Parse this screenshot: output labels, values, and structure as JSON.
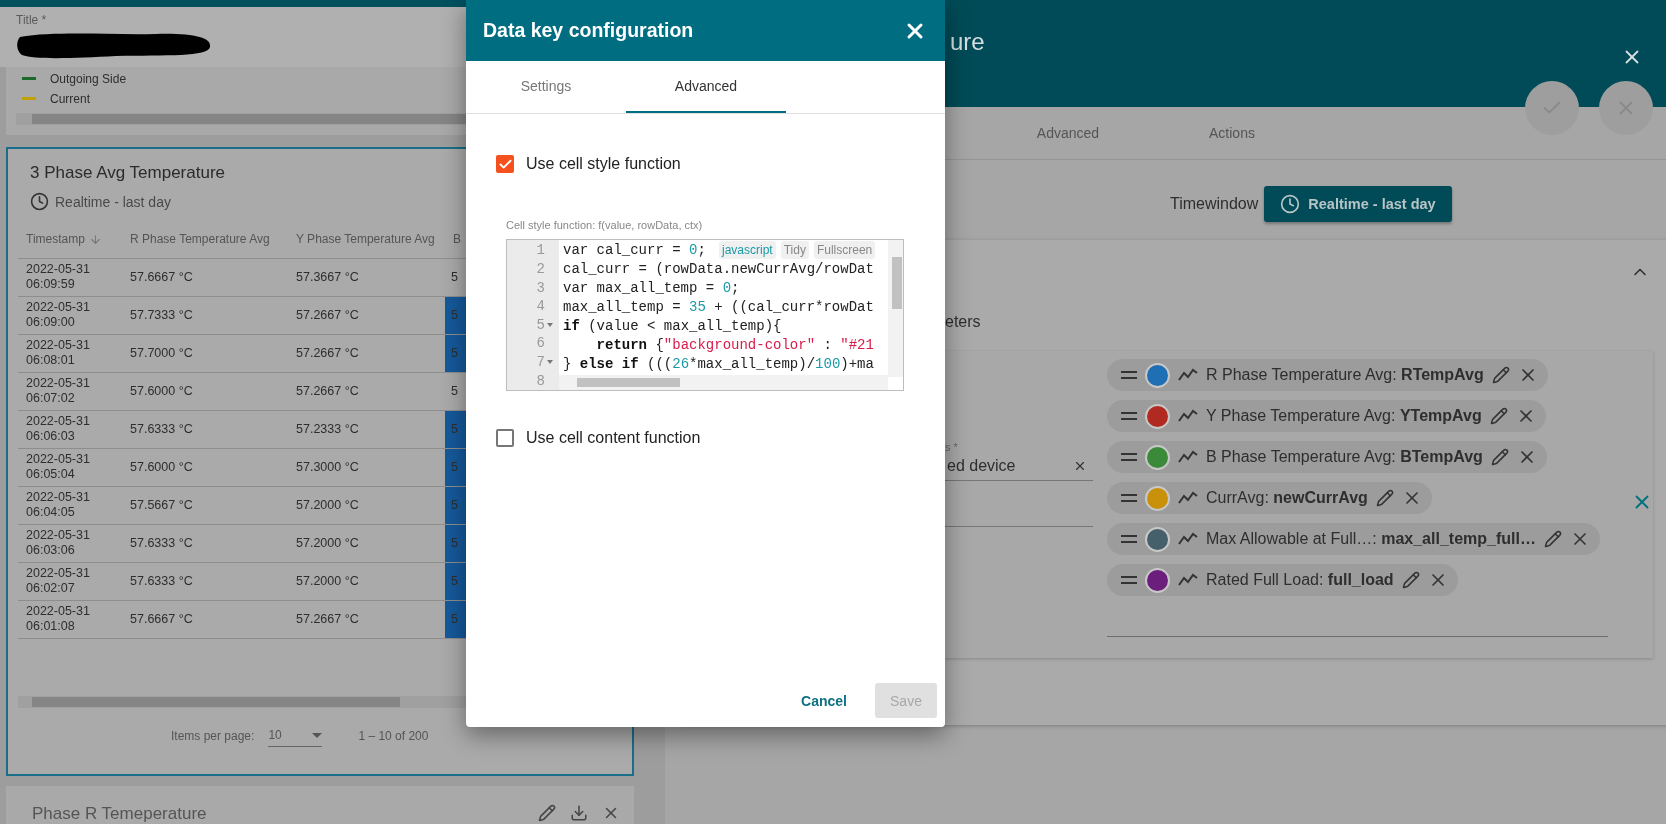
{
  "left_dashboard": {
    "title_field": {
      "label": "Title *"
    },
    "legend": [
      {
        "label": "Outgoing Side",
        "color": "#1b6a2a"
      },
      {
        "label": "Current",
        "color": "#c4a000"
      }
    ],
    "table_widget": {
      "title": "3 Phase Avg Temperature",
      "timewindow": "Realtime - last day",
      "columns": [
        {
          "label": "Timestamp",
          "sorted": true
        },
        {
          "label": "R Phase Temperature Avg",
          "sorted": false
        },
        {
          "label": "Y Phase Temperature Avg",
          "sorted": false
        },
        {
          "label": "B",
          "sorted": false
        }
      ],
      "rows": [
        {
          "date": "2022-05-31",
          "time": "06:09:59",
          "r": "57.6667 °C",
          "y": "57.3667 °C",
          "b": "5",
          "highlighted": false
        },
        {
          "date": "2022-05-31",
          "time": "06:09:00",
          "r": "57.7333 °C",
          "y": "57.2667 °C",
          "b": "5",
          "highlighted": true
        },
        {
          "date": "2022-05-31",
          "time": "06:08:01",
          "r": "57.7000 °C",
          "y": "57.2667 °C",
          "b": "5",
          "highlighted": true
        },
        {
          "date": "2022-05-31",
          "time": "06:07:02",
          "r": "57.6000 °C",
          "y": "57.2667 °C",
          "b": "5",
          "highlighted": false
        },
        {
          "date": "2022-05-31",
          "time": "06:06:03",
          "r": "57.6333 °C",
          "y": "57.2333 °C",
          "b": "5",
          "highlighted": true
        },
        {
          "date": "2022-05-31",
          "time": "06:05:04",
          "r": "57.6000 °C",
          "y": "57.3000 °C",
          "b": "5",
          "highlighted": true
        },
        {
          "date": "2022-05-31",
          "time": "06:04:05",
          "r": "57.5667 °C",
          "y": "57.2000 °C",
          "b": "5",
          "highlighted": true
        },
        {
          "date": "2022-05-31",
          "time": "06:03:06",
          "r": "57.6333 °C",
          "y": "57.2000 °C",
          "b": "5",
          "highlighted": true
        },
        {
          "date": "2022-05-31",
          "time": "06:02:07",
          "r": "57.6333 °C",
          "y": "57.2000 °C",
          "b": "5",
          "highlighted": true
        },
        {
          "date": "2022-05-31",
          "time": "06:01:08",
          "r": "57.6667 °C",
          "y": "57.2667 °C",
          "b": "5",
          "highlighted": true
        }
      ],
      "paginator": {
        "items_per_page_label": "Items per page:",
        "page_size": "10",
        "range": "1 – 10 of 200"
      }
    },
    "next_widget": {
      "title": "Phase R Temeperature"
    }
  },
  "right_panel": {
    "title": "ure",
    "tabs": [
      {
        "label": "Advanced",
        "selected": false
      },
      {
        "label": "Actions",
        "selected": false
      }
    ],
    "timewindow_label": "Timewindow",
    "timewindow_button": "Realtime - last day",
    "section_label": "eters",
    "field": {
      "label": "s *",
      "value": "ed device"
    },
    "data_keys": [
      {
        "text": "R Phase Temperature Avg: **RTempAvg**",
        "color": "#1f6fb5"
      },
      {
        "text": "Y Phase Temperature Avg: **YTempAvg**",
        "color": "#b02a22"
      },
      {
        "text": "B Phase Temperature Avg: **BTempAvg**",
        "color": "#3a8a3a"
      },
      {
        "text": "CurrAvg: **newCurrAvg**",
        "color": "#c9900a"
      },
      {
        "text": "Max Allowable at Full…: **max_all_temp_full…**",
        "color": "#45606b"
      },
      {
        "text": "Rated Full Load: **full_load**",
        "color": "#6c1e7d"
      }
    ]
  },
  "dialog": {
    "title": "Data key configuration",
    "tabs": [
      {
        "label": "Settings",
        "selected": false
      },
      {
        "label": "Advanced",
        "selected": true
      }
    ],
    "options": [
      {
        "label": "Use cell style function",
        "checked": true
      },
      {
        "label": "Use cell content function",
        "checked": false
      }
    ],
    "editor": {
      "label": "Cell style function: f(value, rowData, ctx)",
      "toolbar": [
        {
          "label": "javascript",
          "kind": "mode"
        },
        {
          "label": "Tidy",
          "kind": "action"
        },
        {
          "label": "Fullscreen",
          "kind": "action"
        }
      ],
      "lines": [
        {
          "number": "1",
          "fold": false,
          "tokens": [
            {
              "kind": "plain",
              "text": "var cal_curr = "
            },
            {
              "kind": "number",
              "text": "0"
            },
            {
              "kind": "plain",
              "text": ";"
            }
          ]
        },
        {
          "number": "2",
          "fold": false,
          "tokens": [
            {
              "kind": "plain",
              "text": "cal_curr = (rowData.newCurrAvg/rowDat"
            }
          ]
        },
        {
          "number": "3",
          "fold": false,
          "tokens": [
            {
              "kind": "plain",
              "text": "var max_all_temp = "
            },
            {
              "kind": "number",
              "text": "0"
            },
            {
              "kind": "plain",
              "text": ";"
            }
          ]
        },
        {
          "number": "4",
          "fold": false,
          "tokens": [
            {
              "kind": "plain",
              "text": "max_all_temp = "
            },
            {
              "kind": "number",
              "text": "35"
            },
            {
              "kind": "plain",
              "text": " + ((cal_curr*rowDat"
            }
          ]
        },
        {
          "number": "5",
          "fold": true,
          "tokens": [
            {
              "kind": "keyword",
              "text": "if"
            },
            {
              "kind": "plain",
              "text": " (value < max_all_temp){"
            }
          ]
        },
        {
          "number": "6",
          "fold": false,
          "indented": true,
          "tokens": [
            {
              "kind": "keyword",
              "text": "return"
            },
            {
              "kind": "plain",
              "text": " {"
            },
            {
              "kind": "string",
              "text": "\"background-color\""
            },
            {
              "kind": "plain",
              "text": " : "
            },
            {
              "kind": "string",
              "text": "\"#21"
            }
          ]
        },
        {
          "number": "7",
          "fold": true,
          "tokens": [
            {
              "kind": "plain",
              "text": "} "
            },
            {
              "kind": "keyword",
              "text": "else if"
            },
            {
              "kind": "plain",
              "text": " ((("
            },
            {
              "kind": "number",
              "text": "26"
            },
            {
              "kind": "plain",
              "text": "*max_all_temp)/"
            },
            {
              "kind": "number",
              "text": "100"
            },
            {
              "kind": "plain",
              "text": ")+ma"
            }
          ]
        },
        {
          "number": "8",
          "fold": false
        }
      ]
    },
    "buttons": [
      {
        "label": "Cancel",
        "kind": "text",
        "disabled": false
      },
      {
        "label": "Save",
        "kind": "raised",
        "disabled": true
      }
    ]
  }
}
